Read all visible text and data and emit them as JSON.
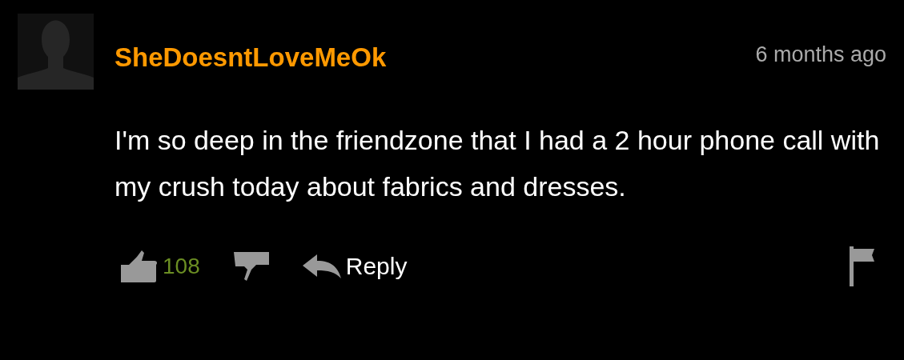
{
  "comment": {
    "author": "SheDoesntLoveMeOk",
    "time": "6 months ago",
    "text": "I'm so deep in the friendzone that I had a 2 hour phone call with my crush today about fabrics and dresses.",
    "likes": "108",
    "reply": "Reply"
  }
}
